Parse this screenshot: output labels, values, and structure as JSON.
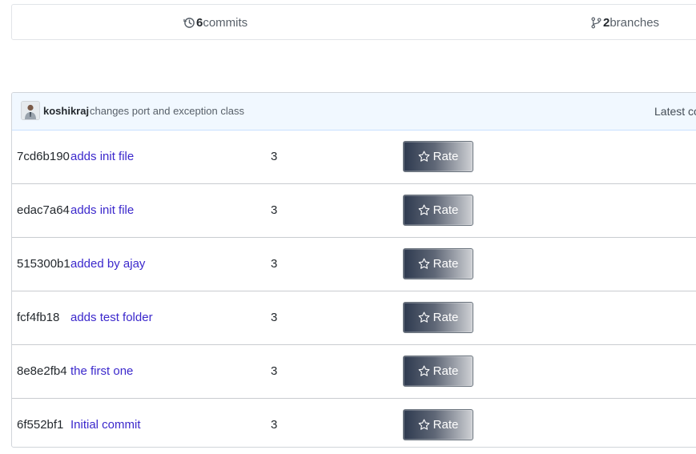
{
  "stats": {
    "commits_count": "6",
    "commits_label": "commits",
    "branches_count": "2",
    "branches_label": "branches"
  },
  "latest_commit": {
    "author": "koshikraj",
    "message": "changes port and exception class",
    "right_text": "Latest co"
  },
  "rate_label": "Rate",
  "commits": [
    {
      "sha": "7cd6b190",
      "message": "adds init file",
      "count": "3"
    },
    {
      "sha": "edac7a64",
      "message": "adds init file",
      "count": "3"
    },
    {
      "sha": "515300b1",
      "message": "added by ajay",
      "count": "3"
    },
    {
      "sha": "fcf4fb18",
      "message": "adds test folder",
      "count": "3"
    },
    {
      "sha": "8e8e2fb4",
      "message": "the first one",
      "count": "3"
    },
    {
      "sha": "6f552bf1",
      "message": "Initial commit",
      "count": "3"
    }
  ],
  "colors": {
    "link": "#3b28cc",
    "header_bg": "#f1f8ff"
  },
  "icons": {
    "commits": "history-icon",
    "branches": "git-branch-icon",
    "rate": "star-icon"
  }
}
